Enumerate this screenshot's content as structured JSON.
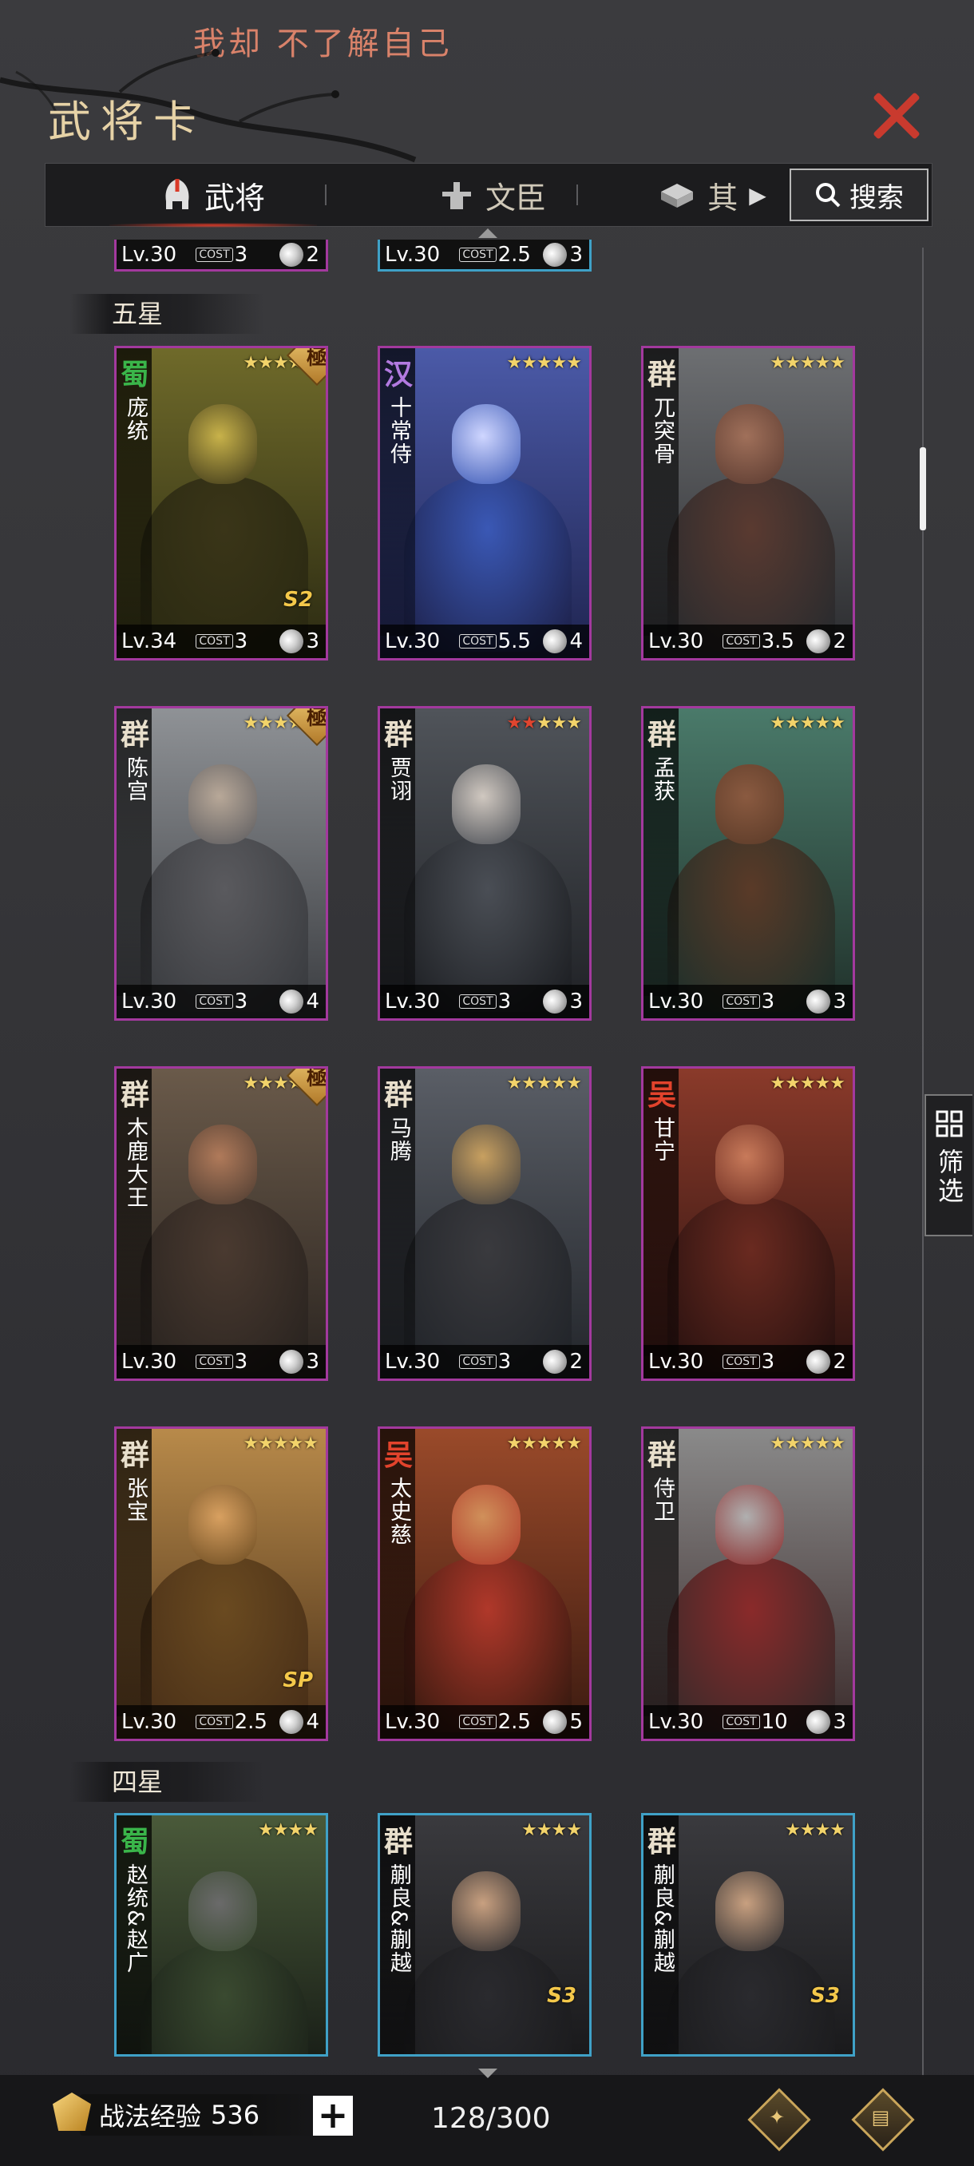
{
  "top_text": "我却 不了解自己",
  "page_title": "武将卡",
  "tabs": [
    {
      "label": "武将",
      "active": true
    },
    {
      "label": "文臣",
      "active": false
    },
    {
      "label": "其",
      "active": false
    }
  ],
  "search_label": "搜索",
  "filter_label": "筛选",
  "partial_row": [
    {
      "lv": "Lv.30",
      "cost": "3",
      "type_value": "2"
    },
    {
      "lv": "Lv.30",
      "cost": "2.5",
      "type_value": "3"
    }
  ],
  "sections": {
    "five_star": "五星",
    "four_star": "四星"
  },
  "cost_tag": "COST",
  "cards": [
    {
      "faction": "蜀",
      "name": "庞统",
      "stars": 5,
      "red_stars": 0,
      "ji": "極",
      "sp": "S2",
      "lv": "Lv.34",
      "cost": "3",
      "type_value": "3",
      "border": "purple"
    },
    {
      "faction": "汉",
      "name": "十常侍",
      "stars": 5,
      "red_stars": 0,
      "ji": "",
      "sp": "",
      "lv": "Lv.30",
      "cost": "5.5",
      "type_value": "4",
      "border": "purple"
    },
    {
      "faction": "群",
      "name": "兀突骨",
      "stars": 5,
      "red_stars": 0,
      "ji": "",
      "sp": "",
      "lv": "Lv.30",
      "cost": "3.5",
      "type_value": "2",
      "border": "purple"
    },
    {
      "faction": "群",
      "name": "陈宫",
      "stars": 5,
      "red_stars": 0,
      "ji": "極",
      "sp": "",
      "lv": "Lv.30",
      "cost": "3",
      "type_value": "4",
      "border": "purple"
    },
    {
      "faction": "群",
      "name": "贾诩",
      "stars": 5,
      "red_stars": 2,
      "ji": "",
      "sp": "",
      "lv": "Lv.30",
      "cost": "3",
      "type_value": "3",
      "border": "purple"
    },
    {
      "faction": "群",
      "name": "孟获",
      "stars": 5,
      "red_stars": 0,
      "ji": "",
      "sp": "",
      "lv": "Lv.30",
      "cost": "3",
      "type_value": "3",
      "border": "purple"
    },
    {
      "faction": "群",
      "name": "木鹿大王",
      "stars": 5,
      "red_stars": 0,
      "ji": "極",
      "sp": "",
      "lv": "Lv.30",
      "cost": "3",
      "type_value": "3",
      "border": "purple"
    },
    {
      "faction": "群",
      "name": "马腾",
      "stars": 5,
      "red_stars": 0,
      "ji": "",
      "sp": "",
      "lv": "Lv.30",
      "cost": "3",
      "type_value": "2",
      "border": "purple"
    },
    {
      "faction": "吴",
      "name": "甘宁",
      "stars": 5,
      "red_stars": 0,
      "ji": "",
      "sp": "",
      "lv": "Lv.30",
      "cost": "3",
      "type_value": "2",
      "border": "purple"
    },
    {
      "faction": "群",
      "name": "张宝",
      "stars": 5,
      "red_stars": 0,
      "ji": "",
      "sp": "SP",
      "lv": "Lv.30",
      "cost": "2.5",
      "type_value": "4",
      "border": "purple"
    },
    {
      "faction": "吴",
      "name": "太史慈",
      "stars": 5,
      "red_stars": 0,
      "ji": "",
      "sp": "",
      "lv": "Lv.30",
      "cost": "2.5",
      "type_value": "5",
      "border": "purple"
    },
    {
      "faction": "群",
      "name": "侍卫",
      "stars": 5,
      "red_stars": 0,
      "ji": "",
      "sp": "",
      "lv": "Lv.30",
      "cost": "10",
      "type_value": "3",
      "border": "purple"
    },
    {
      "faction": "蜀",
      "name": "赵统&赵广",
      "stars": 4,
      "red_stars": 0,
      "ji": "",
      "sp": "",
      "lv": "",
      "cost": "",
      "type_value": "",
      "border": "blue"
    },
    {
      "faction": "群",
      "name": "蒯良&蒯越",
      "stars": 4,
      "red_stars": 0,
      "ji": "",
      "sp": "S3",
      "lv": "",
      "cost": "",
      "type_value": "",
      "border": "blue"
    },
    {
      "faction": "群",
      "name": "蒯良&蒯越",
      "stars": 4,
      "red_stars": 0,
      "ji": "",
      "sp": "S3",
      "lv": "",
      "cost": "",
      "type_value": "",
      "border": "blue"
    }
  ],
  "bottom_bar": {
    "exp_label": "战法经验",
    "exp_value": "536",
    "plus": "+",
    "count": "128/300"
  },
  "colors": {
    "faction_shu": "#3ab54a",
    "faction_qun": "#e8dfcc",
    "faction_wu": "#e2432c",
    "faction_han": "#b27ae0",
    "accent_red": "#c93a2e",
    "purple_border": "#a3399e",
    "blue_border": "#3fa1c7"
  }
}
